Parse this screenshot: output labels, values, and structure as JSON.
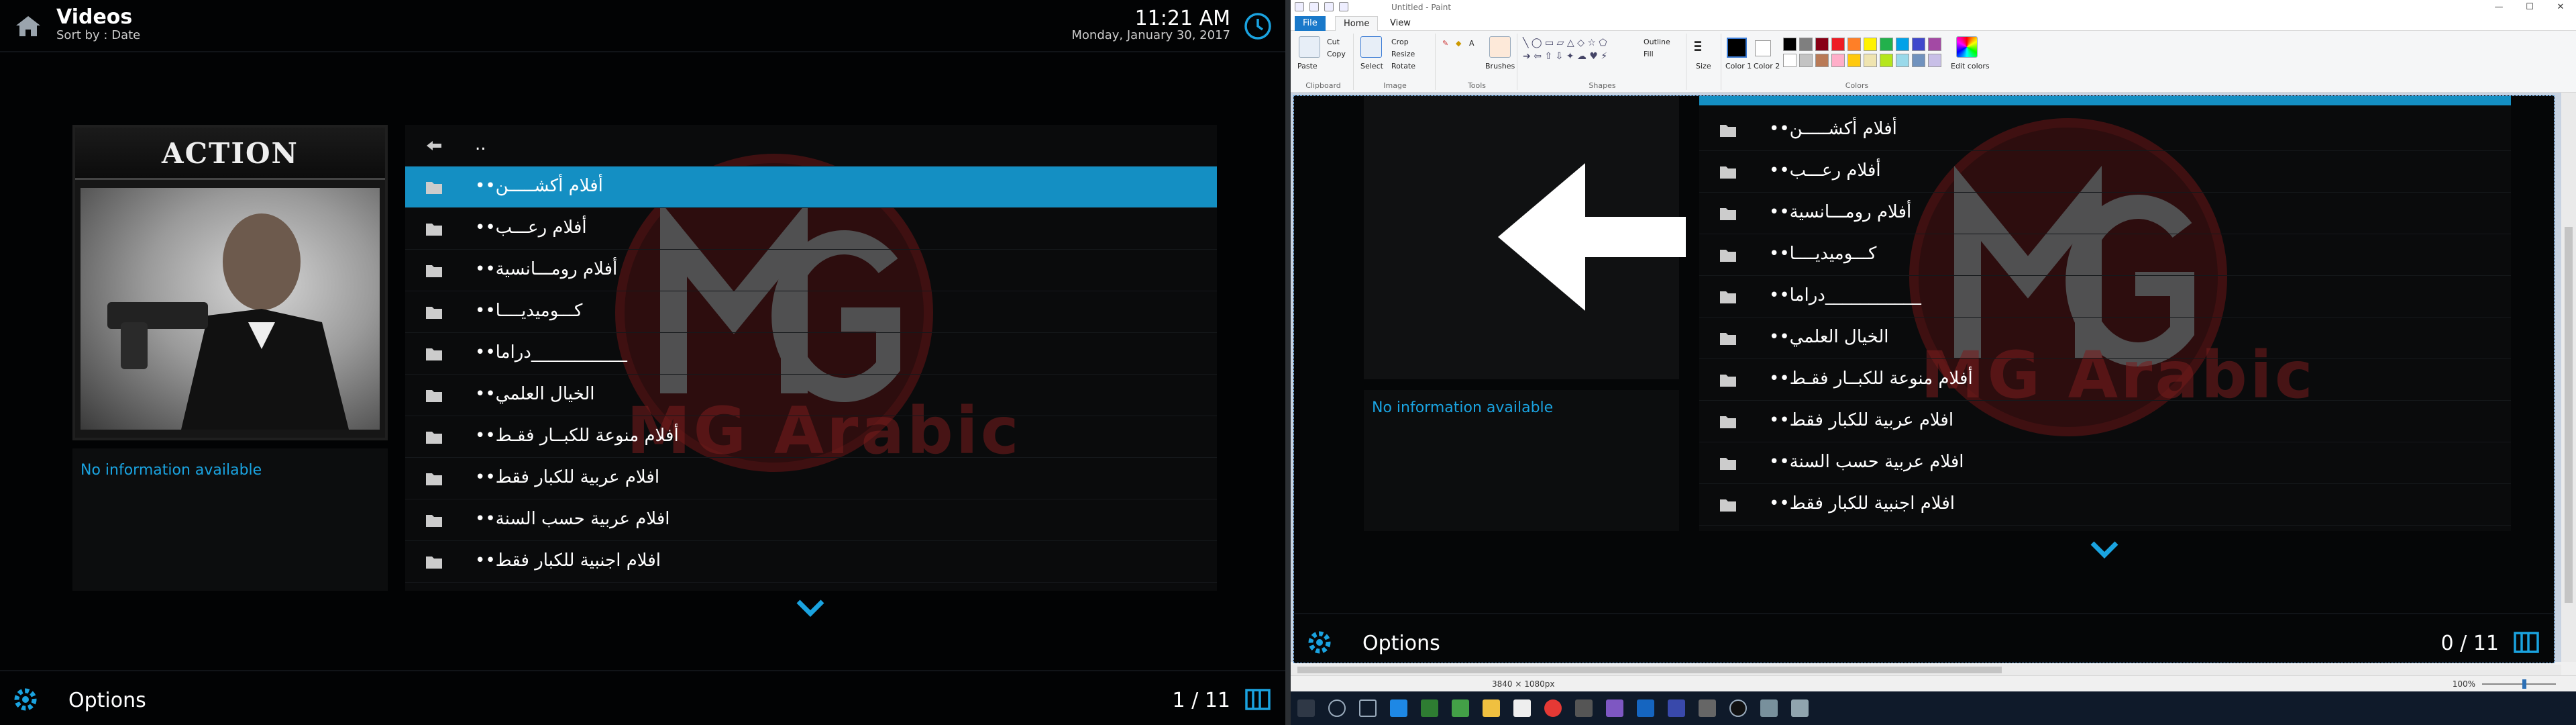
{
  "kodi": {
    "header": {
      "title": "Videos",
      "subtitle": "Sort by : Date",
      "time": "11:21 AM",
      "date": "Monday, January 30, 2017"
    },
    "poster": {
      "banner": "ACTION"
    },
    "info": {
      "no_info": "No information available"
    },
    "list": {
      "parent": "..",
      "items": [
        "••أفلام أكشـــــن",
        "••أفلام رعـــب",
        "••أفلام رومـــانسية",
        "••كـــوميديــــا",
        "••دراما___________",
        "••الخيال العلمي",
        "••أفلام منوعة للكبــار فقـط",
        "••افلام عربية للكبار فقط",
        "••افلام عربية حسب السنة",
        "••افلام اجنبية للكبار فقط"
      ],
      "selected_index": 0,
      "watermark": "MG Arabic"
    },
    "footer": {
      "options": "Options",
      "count": "1 / 11"
    }
  },
  "paint": {
    "title": "Untitled - Paint",
    "window_buttons": [
      "—",
      "☐",
      "✕"
    ],
    "tabs": {
      "file": "File",
      "home": "Home",
      "view": "View"
    },
    "ribbon": {
      "paste": "Paste",
      "cut": "Cut",
      "copy": "Copy",
      "select": "Select",
      "crop": "Crop",
      "resize": "Resize",
      "rotate": "Rotate",
      "brushes": "Brushes",
      "outline": "Outline",
      "fill": "Fill",
      "size": "Size",
      "color1": "Color 1",
      "color2": "Color 2",
      "edit_colors": "Edit colors",
      "groups": [
        "Clipboard",
        "Image",
        "Tools",
        "Shapes",
        "Colors"
      ]
    },
    "palette": [
      "#000000",
      "#7f7f7f",
      "#880015",
      "#ed1c24",
      "#ff7f27",
      "#fff200",
      "#22b14c",
      "#00a2e8",
      "#3f48cc",
      "#a349a4",
      "#ffffff",
      "#c3c3c3",
      "#b97a57",
      "#ffaec9",
      "#ffc90e",
      "#efe4b0",
      "#b5e61d",
      "#99d9ea",
      "#7092be",
      "#c8bfe7"
    ],
    "status": {
      "dimensions": "3840 × 1080px",
      "zoom": "100%"
    },
    "inner": {
      "no_info": "No information available",
      "items": [
        "••أفلام أكشـــــن",
        "••أفلام رعـــب",
        "••أفلام رومـــانسية",
        "••كـــوميديــــا",
        "••دراما___________",
        "••الخيال العلمي",
        "••أفلام منوعة للكبــار فقـط",
        "••افلام عربية للكبار فقط",
        "••افلام عربية حسب السنة",
        "••افلام اجنبية للكبار فقط"
      ],
      "watermark": "MG Arabic",
      "options": "Options",
      "count": "0 / 11"
    }
  },
  "colors": {
    "accent": "#148fc3",
    "info_text": "#1aa3e0",
    "bg": "#020304"
  }
}
